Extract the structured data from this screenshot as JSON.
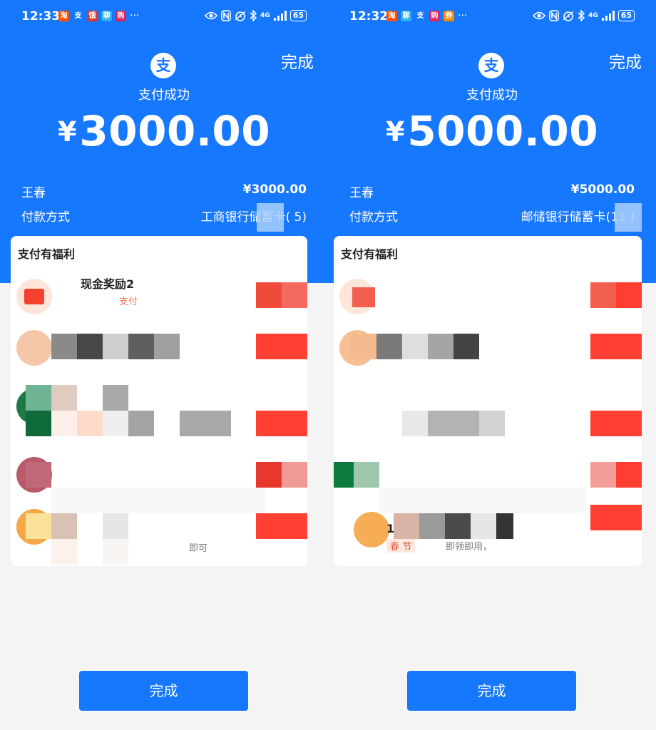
{
  "panels": {
    "left": {
      "status": {
        "time": "12:33",
        "battery": "65"
      },
      "done_top": "完成",
      "logo": "支",
      "title": "支付成功",
      "currency": "¥",
      "amount": "3000.00",
      "payee_name": "王春",
      "payee_amount": "¥3000.00",
      "method_label": "付款方式",
      "method_value": "工商银行储蓄卡(   5)",
      "card_title": "支付有福利",
      "benefits": [
        {
          "title": "现金奖励2",
          "sub": "支付"
        },
        {},
        {},
        {},
        {
          "sub": "即可"
        }
      ],
      "done_bottom": "完成"
    },
    "right": {
      "status": {
        "time": "12:32",
        "battery": "65"
      },
      "done_top": "完成",
      "logo": "支",
      "title": "支付成功",
      "currency": "¥",
      "amount": "5000.00",
      "payee_name": "王春",
      "payee_amount": "¥5000.00",
      "method_label": "付款方式",
      "method_value": "邮储银行储蓄卡(11   )",
      "card_title": "支付有福利",
      "benefits": [
        {},
        {},
        {},
        {},
        {
          "title": "1      免费",
          "tag": "春  节",
          "sub": "即领即用，"
        }
      ],
      "done_bottom": "完成"
    }
  },
  "status_notifications_left": [
    "淘",
    "支",
    "饿",
    "聊",
    "购"
  ],
  "status_notifications_right": [
    "淘",
    "聊",
    "支",
    "购",
    "券"
  ],
  "status_more": "···",
  "status_signal": "4G",
  "colors": {
    "primary_blue": "#1677ff",
    "button_red": "#ff4033",
    "background": "#f4f4f4",
    "white": "#ffffff"
  },
  "icons": [
    "eye-icon",
    "nfc-icon",
    "alarm-icon",
    "bluetooth-icon",
    "signal-icon",
    "battery-icon",
    "alipay-logo-icon"
  ]
}
